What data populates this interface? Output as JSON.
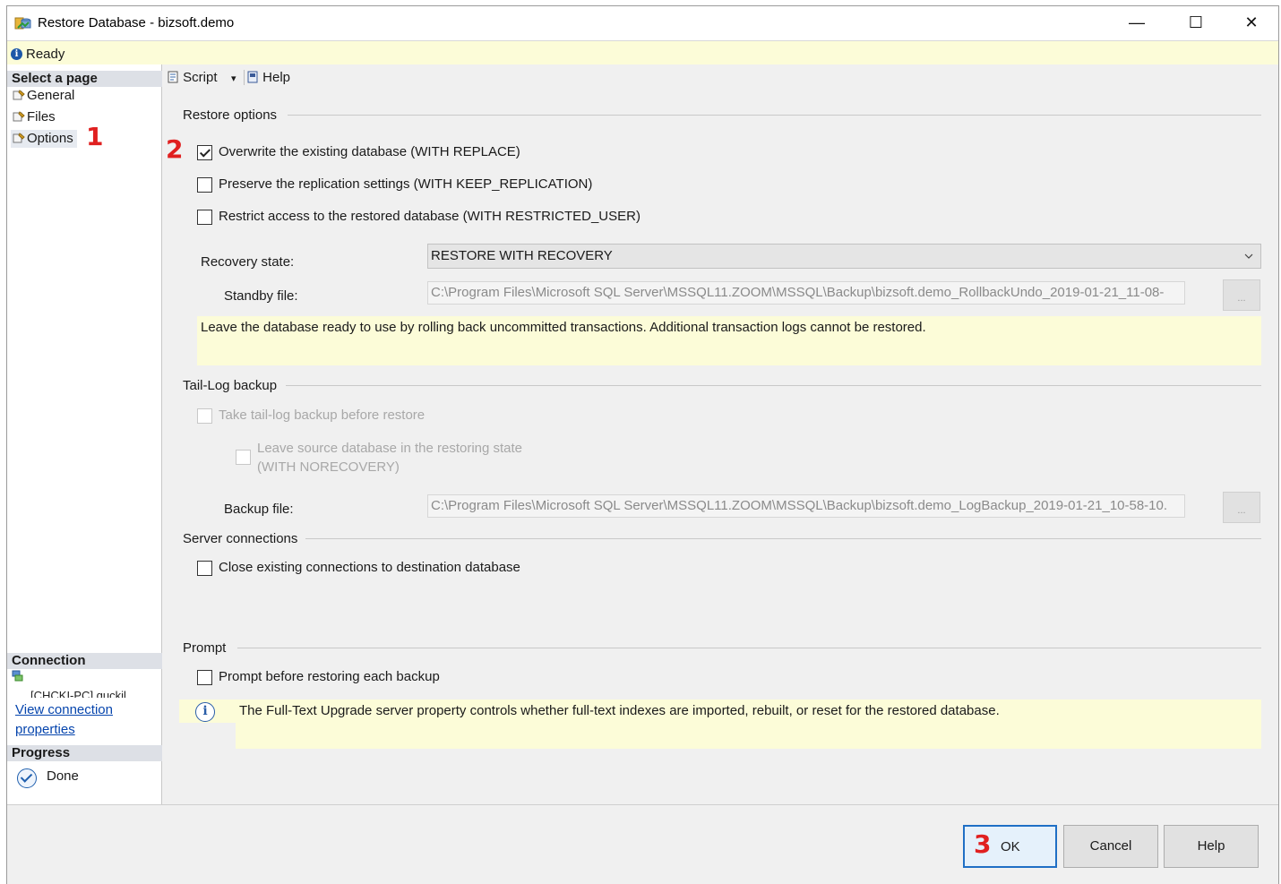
{
  "window": {
    "title": "Restore Database - bizsoft.demo",
    "minimize_glyph": "—",
    "maximize_glyph": "☐",
    "close_glyph": "✕"
  },
  "status": {
    "text": "Ready"
  },
  "left_pane": {
    "select_page_header": "Select a page",
    "pages": [
      {
        "label": "General",
        "icon": "page-wrench-icon"
      },
      {
        "label": "Files",
        "icon": "page-wrench-icon"
      },
      {
        "label": "Options",
        "icon": "page-wrench-icon",
        "selected": true
      }
    ],
    "marker_1": "1",
    "connection_header": "Connection",
    "connection_server": "[CHCKI-PC] quckil",
    "view_connection_line1": "View connection",
    "view_connection_line2": "properties",
    "progress_header": "Progress",
    "progress_status": "Done"
  },
  "toolbar": {
    "script_label": "Script",
    "script_dropdown_glyph": "▾",
    "help_label": "Help"
  },
  "restore_options": {
    "header": "Restore options",
    "marker_2": "2",
    "overwrite": {
      "label": "Overwrite the existing database (WITH REPLACE)",
      "checked": true
    },
    "preserve_replication": {
      "label": "Preserve the replication settings (WITH KEEP_REPLICATION)",
      "checked": false
    },
    "restrict_access": {
      "label": "Restrict access to the restored database (WITH RESTRICTED_USER)",
      "checked": false
    },
    "recovery_state_label": "Recovery state:",
    "recovery_state_value": "RESTORE WITH RECOVERY",
    "standby_file_label": "Standby file:",
    "standby_file_value": "C:\\Program Files\\Microsoft SQL Server\\MSSQL11.ZOOM\\MSSQL\\Backup\\bizsoft.demo_RollbackUndo_2019-01-21_11-08-",
    "browse_label": "...",
    "recovery_note": "Leave the database ready to use by rolling back uncommitted transactions. Additional transaction logs cannot be restored."
  },
  "tail_log": {
    "header": "Tail-Log backup",
    "take_backup": {
      "label": "Take tail-log backup before restore",
      "checked": false,
      "enabled": false
    },
    "leave_source_line1": "Leave source database in the restoring state",
    "leave_source_line2": "(WITH NORECOVERY)",
    "backup_file_label": "Backup file:",
    "backup_file_value": "C:\\Program Files\\Microsoft SQL Server\\MSSQL11.ZOOM\\MSSQL\\Backup\\bizsoft.demo_LogBackup_2019-01-21_10-58-10.",
    "browse_label": "..."
  },
  "server_connections": {
    "header": "Server connections",
    "close_existing": {
      "label": "Close existing connections to destination database",
      "checked": false
    }
  },
  "prompt": {
    "header": "Prompt",
    "prompt_before": {
      "label": "Prompt before restoring each backup",
      "checked": false
    },
    "fulltext_note": "The Full-Text Upgrade server property controls whether full-text indexes are imported, rebuilt, or reset for the restored database."
  },
  "buttons": {
    "marker_3": "3",
    "ok": "OK",
    "cancel": "Cancel",
    "help": "Help"
  },
  "colors": {
    "note_background": "#fcfcd8",
    "marker_red": "#e02020",
    "link_blue": "#0645ad",
    "primary_border": "#1f6fc5"
  }
}
